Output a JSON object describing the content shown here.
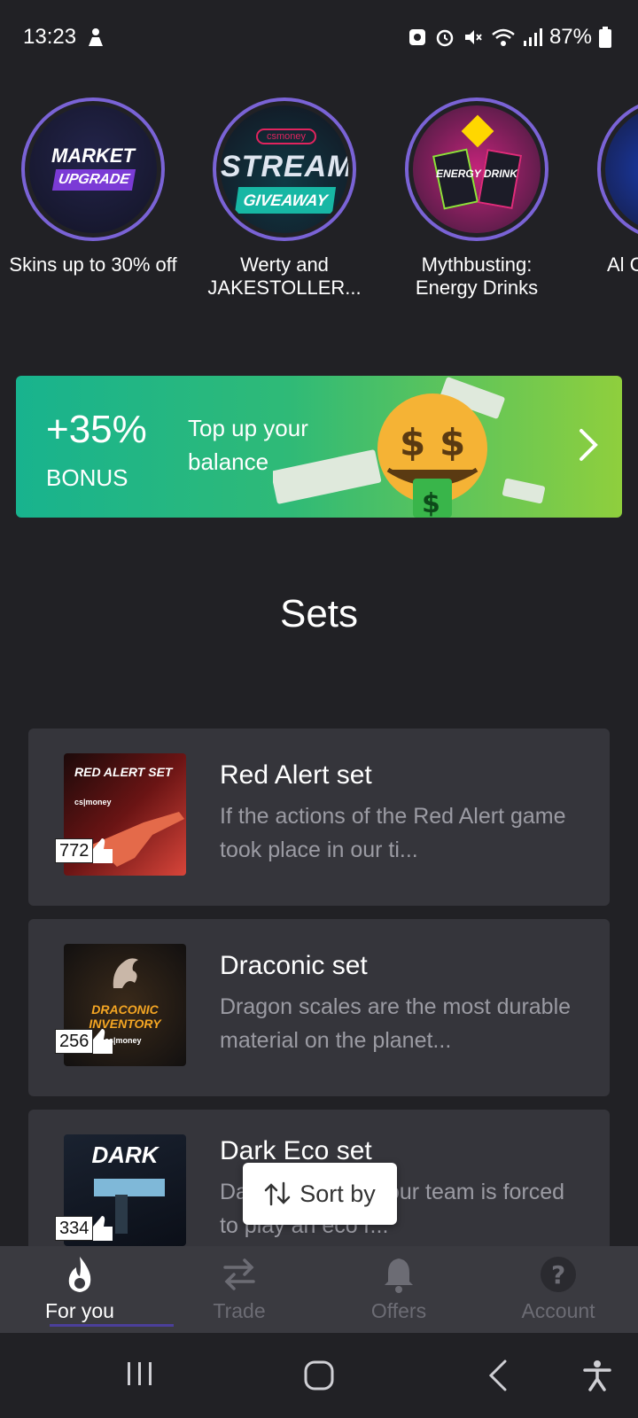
{
  "status_bar": {
    "time": "13:23",
    "battery": "87%"
  },
  "stories": [
    {
      "caption": "Skins up to 30% off",
      "art_title": "MARKET",
      "art_subtitle": "UPGRADE"
    },
    {
      "caption": "Werty and JAKESTOLLER...",
      "art_badge": "csmoney",
      "art_title": "STREAM",
      "art_subtitle": "GIVEAWAY"
    },
    {
      "caption": "Mythbusting: Energy Drinks",
      "art_title": "ENERGY DRINK"
    },
    {
      "caption": "Al CS"
    }
  ],
  "banner": {
    "percent": "+35%",
    "bonus": "BONUS",
    "text": "Top up your balance"
  },
  "section_title": "Sets",
  "sets": [
    {
      "title": "Red Alert set",
      "description": "If the actions of the Red Alert game took place in our ti...",
      "likes": "772",
      "thumb_title": "RED ALERT SET",
      "thumb_brand": "cs|money"
    },
    {
      "title": "Draconic set",
      "description": "Dragon scales are the most durable material on the planet...",
      "likes": "256",
      "thumb_title": "DRACONIC INVENTORY",
      "thumb_brand": "cs|money"
    },
    {
      "title": "Dark Eco set",
      "description": "Da... come and your team is forced to play an eco r...",
      "likes": "334",
      "thumb_title": "DARK"
    }
  ],
  "sort_button": "Sort by",
  "tabs": [
    {
      "label": "For you",
      "icon": "flame-icon",
      "active": true
    },
    {
      "label": "Trade",
      "icon": "swap-arrows-icon",
      "active": false
    },
    {
      "label": "Offers",
      "icon": "bell-icon",
      "active": false
    },
    {
      "label": "Account",
      "icon": "question-icon",
      "active": false
    }
  ],
  "colors": {
    "background": "#212125",
    "card": "#35353b",
    "accent_ring": "#7a63d6",
    "banner_start": "#18b38e",
    "banner_end": "#8fcf3d"
  }
}
